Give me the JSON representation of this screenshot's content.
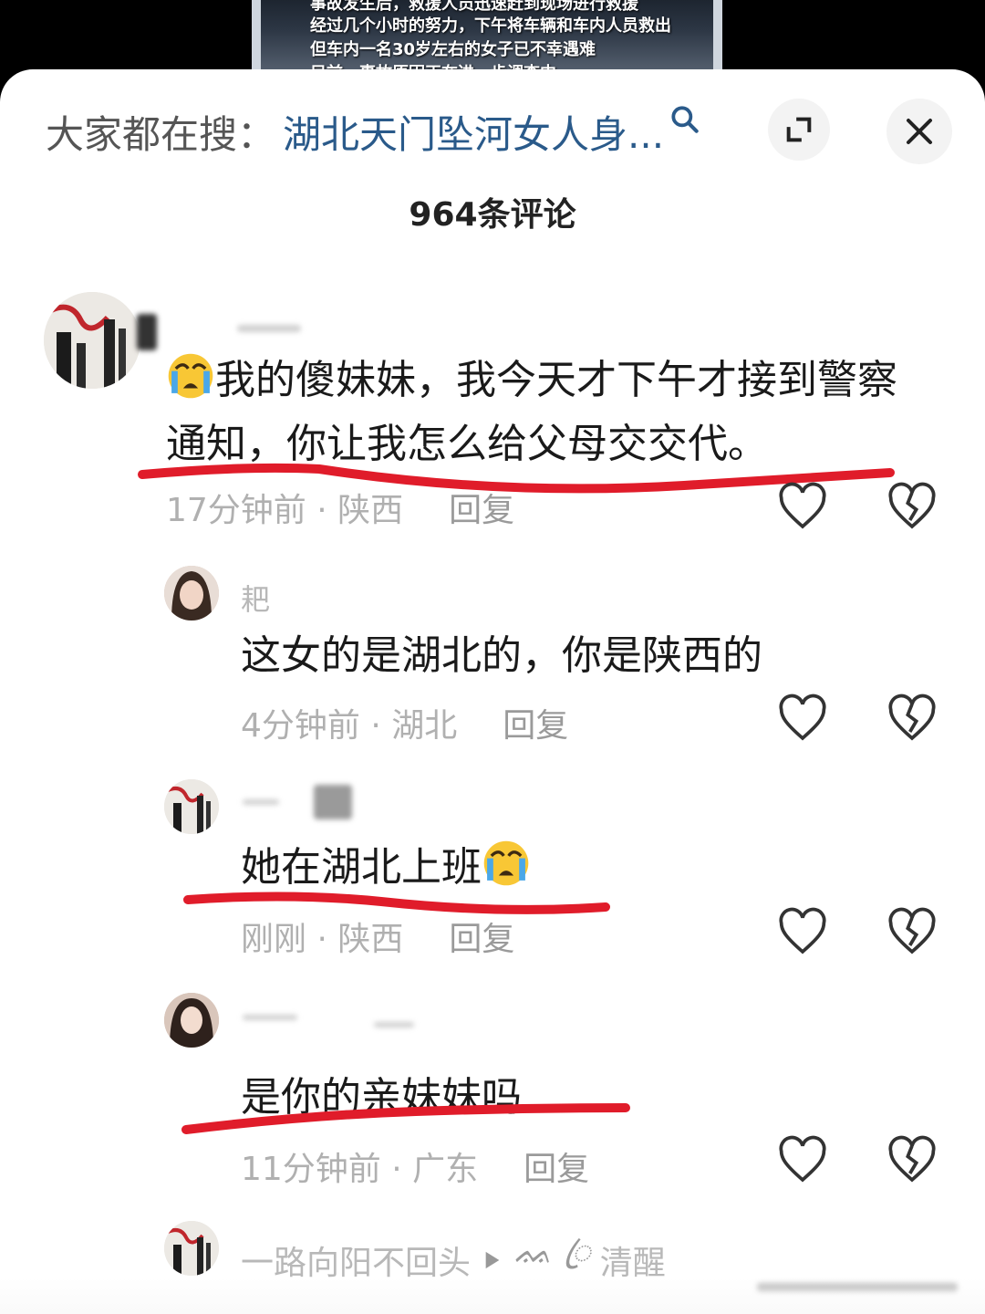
{
  "video_overlay": {
    "lines": [
      "事故发生后，救援人员迅速赶到现场进行救援",
      "经过几个小时的努力，下午将车辆和车内人员救出",
      "但车内一名30岁左右的女子已不幸遇难",
      "目前，事故原因正在进一步调查中"
    ]
  },
  "header": {
    "search_prefix": "大家都在搜：",
    "search_query": "湖北天门坠河女人身...",
    "comment_count": "964条评论"
  },
  "comments": [
    {
      "username": "",
      "text_line1": "我的傻妹妹，我今天才下午才接到警察",
      "text_line2": "通知，你让我怎么给父母交交代。",
      "time_location": "17分钟前 · 陕西",
      "reply": "回复"
    },
    {
      "username": "耙",
      "text": "这女的是湖北的，你是陕西的",
      "time_location": "4分钟前 · 湖北",
      "reply": "回复"
    },
    {
      "username": "",
      "text": "她在湖北上班",
      "time_location": "刚刚 · 陕西",
      "reply": "回复"
    },
    {
      "username": "",
      "text": "是你的亲妹妹吗",
      "time_location": "11分钟前 · 广东",
      "reply": "回复"
    },
    {
      "username": "一路向阳不回头",
      "reply_to": "清醒",
      "reply_decoration": "ᨐ ꦿ"
    }
  ],
  "colors": {
    "underline": "#e01c2a",
    "query": "#2a5a8a"
  }
}
